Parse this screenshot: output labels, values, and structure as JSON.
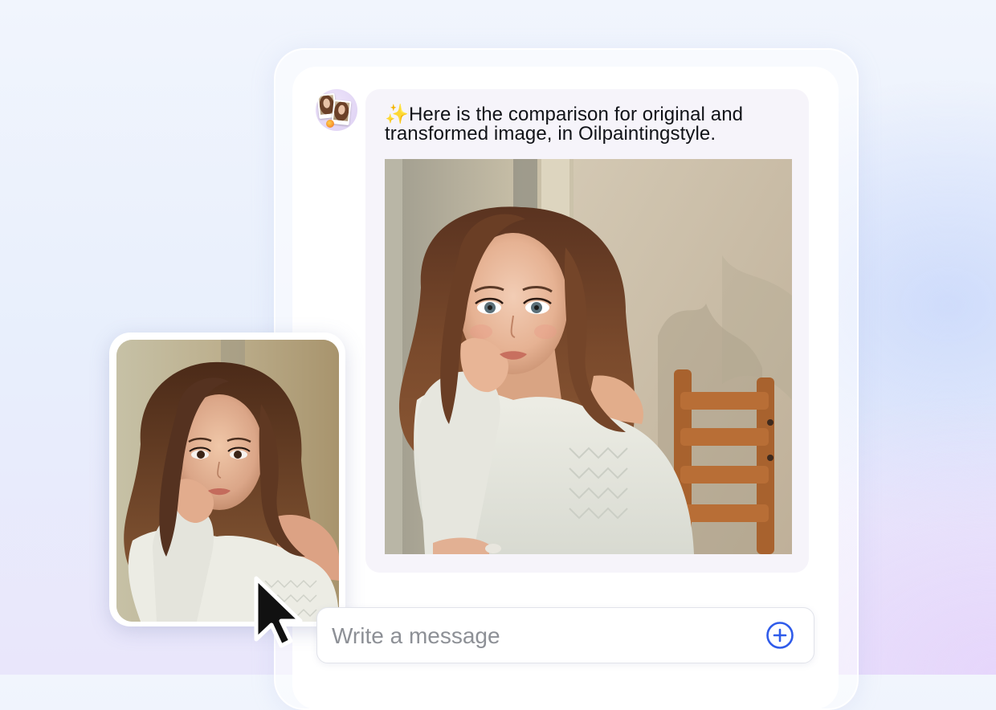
{
  "chat": {
    "assistant_message": {
      "sparkle_emoji": "✨",
      "text": "Here is the comparison for original and transformed image, in Oilpaintingstyle."
    }
  },
  "composer": {
    "placeholder": "Write a message",
    "add_icon": "plus-circle-icon"
  },
  "colors": {
    "accent": "#2f5bea",
    "bubble_bg": "#f6f4fa",
    "avatar_bg": "#e7dcf7"
  },
  "icons": {
    "cursor": "pointer-cursor-icon",
    "avatar": "photo-comparison-avatar-icon"
  }
}
